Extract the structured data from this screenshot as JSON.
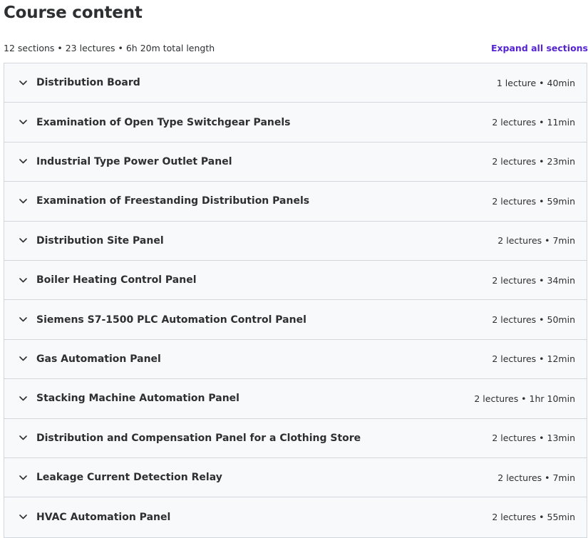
{
  "header": {
    "title": "Course content",
    "summary": "12 sections • 23 lectures • 6h 20m total length",
    "expand_all_label": "Expand all sections"
  },
  "colors": {
    "accent": "#5624d0",
    "section_bg": "#f7f9fa",
    "border": "#d1d7dc",
    "text": "#2d2f31"
  },
  "sections": [
    {
      "title": "Distribution Board",
      "meta": "1 lecture • 40min",
      "icon": "chevron-down-icon"
    },
    {
      "title": "Examination of Open Type Switchgear Panels",
      "meta": "2 lectures • 11min",
      "icon": "chevron-down-icon"
    },
    {
      "title": "Industrial Type Power Outlet Panel",
      "meta": "2 lectures • 23min",
      "icon": "chevron-down-icon"
    },
    {
      "title": "Examination of Freestanding Distribution Panels",
      "meta": "2 lectures • 59min",
      "icon": "chevron-down-icon"
    },
    {
      "title": "Distribution Site Panel",
      "meta": "2 lectures • 7min",
      "icon": "chevron-down-icon"
    },
    {
      "title": "Boiler Heating Control Panel",
      "meta": "2 lectures • 34min",
      "icon": "chevron-down-icon"
    },
    {
      "title": "Siemens S7-1500 PLC Automation Control Panel",
      "meta": "2 lectures • 50min",
      "icon": "chevron-down-icon"
    },
    {
      "title": "Gas Automation Panel",
      "meta": "2 lectures • 12min",
      "icon": "chevron-down-icon"
    },
    {
      "title": "Stacking Machine Automation Panel",
      "meta": "2 lectures • 1hr 10min",
      "icon": "chevron-down-icon"
    },
    {
      "title": "Distribution and Compensation Panel for a Clothing Store",
      "meta": "2 lectures • 13min",
      "icon": "chevron-down-icon"
    },
    {
      "title": "Leakage Current Detection Relay",
      "meta": "2 lectures • 7min",
      "icon": "chevron-down-icon"
    },
    {
      "title": "HVAC Automation Panel",
      "meta": "2 lectures • 55min",
      "icon": "chevron-down-icon"
    }
  ]
}
